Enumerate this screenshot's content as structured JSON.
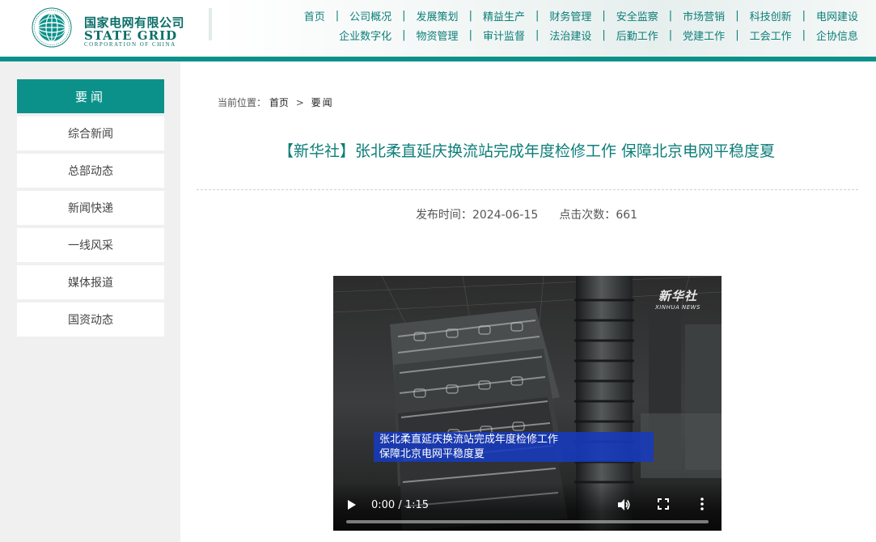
{
  "brand": {
    "name_cn": "国家电网有限公司",
    "name_en": "STATE GRID",
    "name_en_sub": "CORPORATION OF CHINA",
    "accent_color": "#0c918a"
  },
  "nav": {
    "row1": [
      "首页",
      "公司概况",
      "发展策划",
      "精益生产",
      "财务管理",
      "安全监察",
      "市场营销",
      "科技创新",
      "电网建设"
    ],
    "row2": [
      "企业数字化",
      "物资管理",
      "审计监督",
      "法治建设",
      "后勤工作",
      "党建工作",
      "工会工作",
      "企协信息"
    ]
  },
  "sidebar": {
    "heading": "要闻",
    "items": [
      "综合新闻",
      "总部动态",
      "新闻快递",
      "一线风采",
      "媒体报道",
      "国资动态"
    ]
  },
  "breadcrumb": {
    "label": "当前位置：",
    "home": "首页",
    "separator": ">",
    "current": "要闻"
  },
  "article": {
    "title": "【新华社】张北柔直延庆换流站完成年度检修工作 保障北京电网平稳度夏",
    "publish_label": "发布时间：",
    "publish_date": "2024-06-15",
    "views_label": "点击次数：",
    "views": "661"
  },
  "video": {
    "watermark_cn": "新华社",
    "watermark_en": "XINHUA NEWS",
    "caption_line1": "张北柔直延庆换流站完成年度检修工作",
    "caption_line2": "保障北京电网平稳度夏",
    "time_display": "0:00 / 1:15",
    "progress": 0,
    "play_icon": "play-icon",
    "volume_icon": "volume-icon",
    "fullscreen_icon": "fullscreen-icon",
    "more_icon": "more-vert-icon"
  }
}
